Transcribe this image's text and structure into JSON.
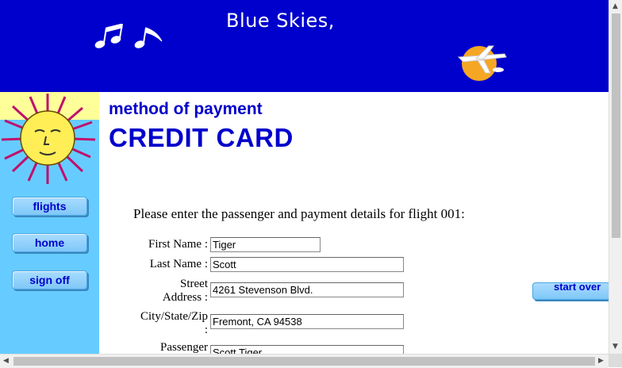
{
  "header": {
    "brand": "Blue Skies,"
  },
  "nav": {
    "flights": "flights",
    "home": "home",
    "signoff": "sign off"
  },
  "page": {
    "subtitle": "method of payment",
    "title": "CREDIT CARD",
    "intro": "Please enter the passenger and payment details for flight 001:"
  },
  "form": {
    "first_name": {
      "label": "First Name :",
      "value": "Tiger"
    },
    "last_name": {
      "label": "Last Name :",
      "value": "Scott"
    },
    "street": {
      "label_line1": "Street",
      "label_line2": "Address :",
      "value": "4261 Stevenson Blvd."
    },
    "city": {
      "label_line1": "City/State/Zip",
      "label_line2": ":",
      "value": "Fremont, CA 94538"
    },
    "passenger": {
      "label": "Passenger",
      "value": "Scott Tiger"
    }
  },
  "actions": {
    "start_over": "start over"
  },
  "colors": {
    "banner": "#0000cc",
    "sidebar": "#66ccff",
    "accent_text": "#0000cc"
  },
  "icons": [
    "music-notes-icon",
    "plane-sun-logo-icon",
    "sun-face-icon",
    "scroll-up-icon",
    "scroll-down-icon",
    "scroll-left-icon",
    "scroll-right-icon"
  ]
}
